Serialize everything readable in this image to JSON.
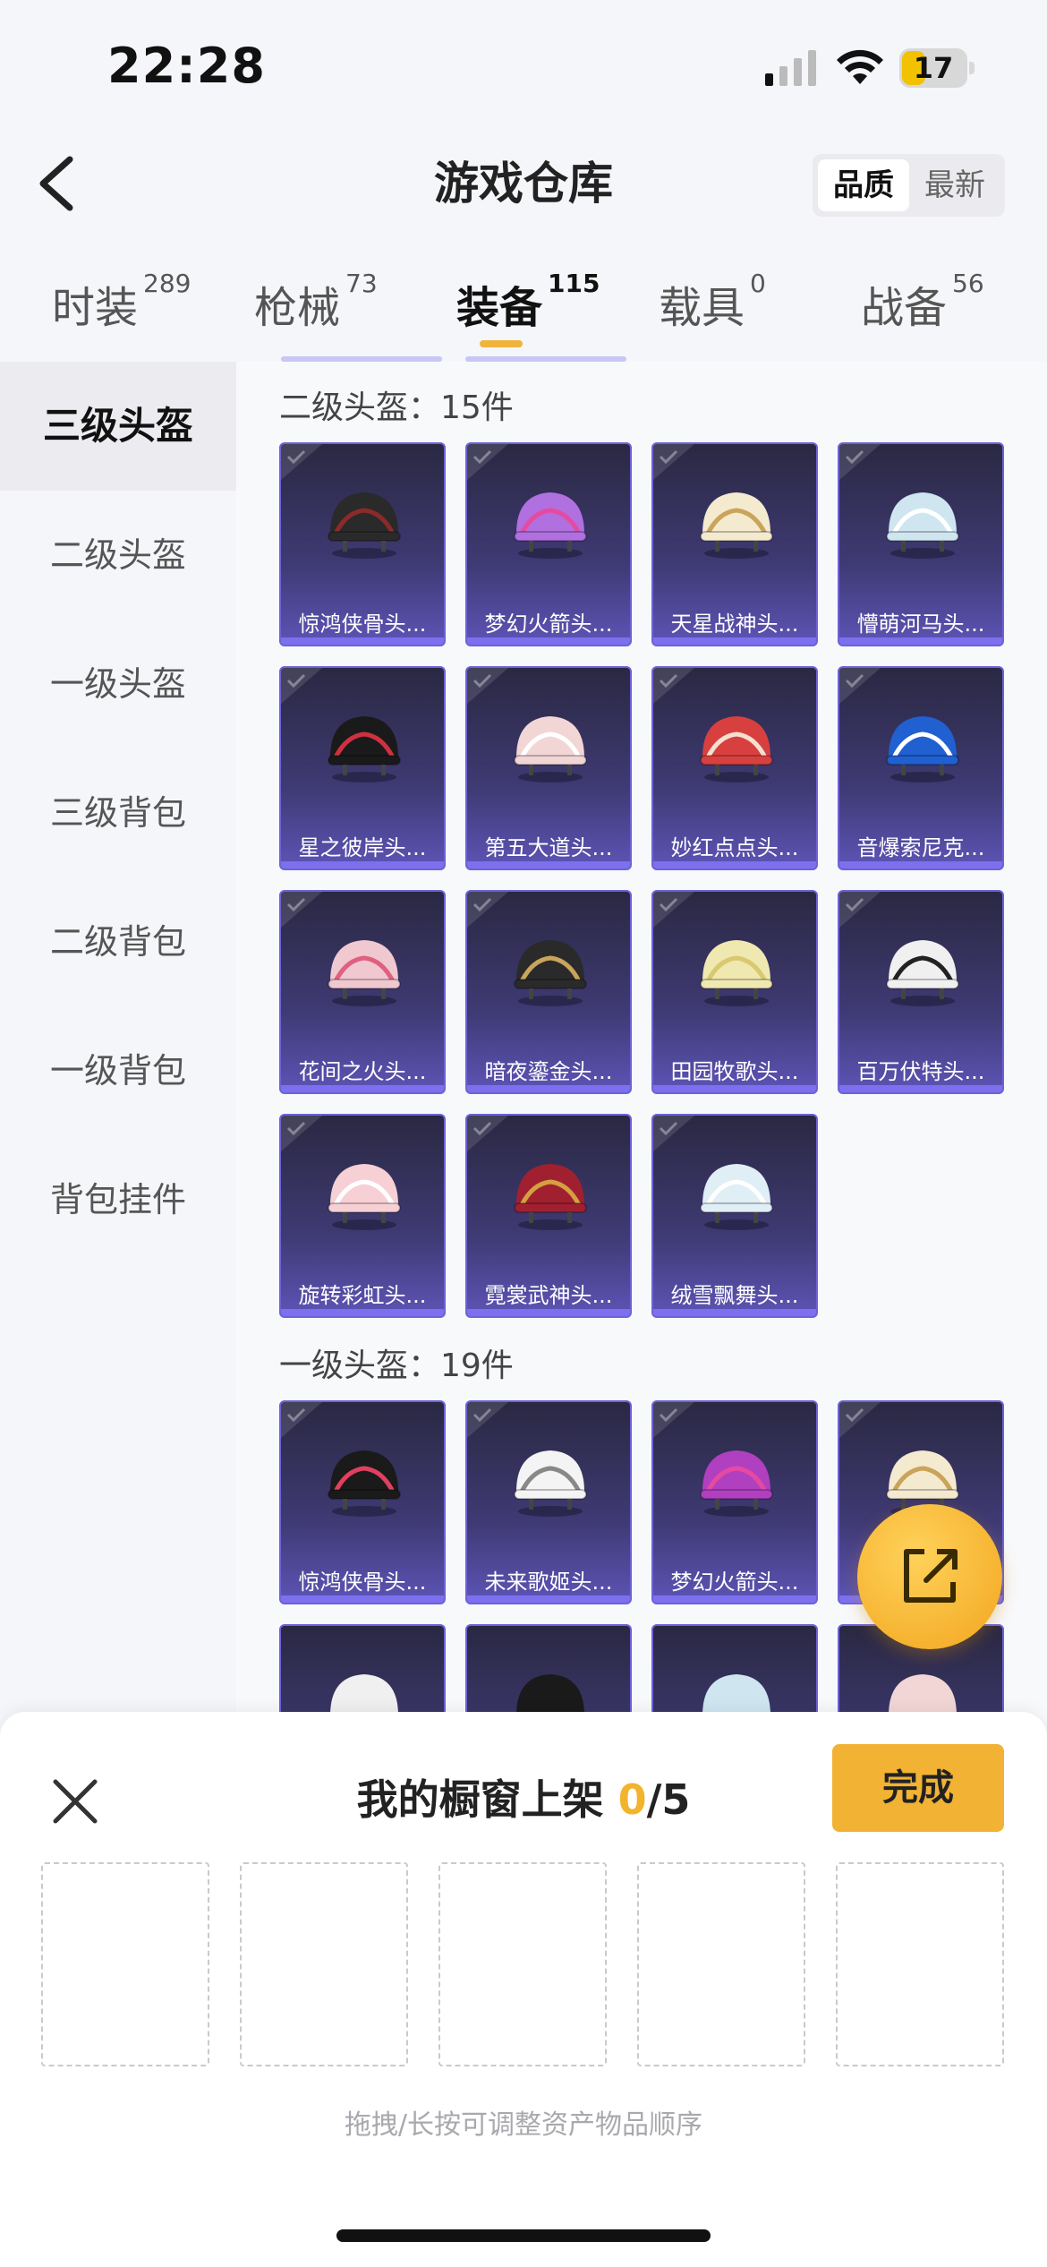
{
  "status_bar": {
    "time": "22:28",
    "battery": "17"
  },
  "header": {
    "title": "游戏仓库",
    "sort_options": [
      "品质",
      "最新"
    ]
  },
  "tabs": [
    {
      "label": "时装",
      "count": "289"
    },
    {
      "label": "枪械",
      "count": "73"
    },
    {
      "label": "装备",
      "count": "115"
    },
    {
      "label": "载具",
      "count": "0"
    },
    {
      "label": "战备",
      "count": "56"
    }
  ],
  "sidebar": {
    "items": [
      "三级头盔",
      "二级头盔",
      "一级头盔",
      "三级背包",
      "二级背包",
      "一级背包",
      "背包挂件"
    ]
  },
  "sections": [
    {
      "title": "二级头盔：15件",
      "items": [
        "惊鸿侠骨头...",
        "梦幻火箭头...",
        "天星战神头...",
        "懵萌河马头...",
        "星之彼岸头...",
        "第五大道头...",
        "妙红点点头...",
        "音爆索尼克...",
        "花间之火头...",
        "暗夜鎏金头...",
        "田园牧歌头...",
        "百万伏特头...",
        "旋转彩虹头...",
        "霓裳武神头...",
        "绒雪飘舞头..."
      ]
    },
    {
      "title": "一级头盔：19件",
      "items": [
        "惊鸿侠骨头...",
        "未来歌姬头...",
        "梦幻火箭头...",
        ""
      ]
    }
  ],
  "sheet": {
    "title_prefix": "我的橱窗上架 ",
    "count": "0",
    "total": "/5",
    "done_label": "完成",
    "hint": "拖拽/长按可调整资产物品顺序"
  },
  "colors": {
    "accent": "#f2b233",
    "card_border": "#6d62d8",
    "card_bottom": "#5d54b6"
  }
}
